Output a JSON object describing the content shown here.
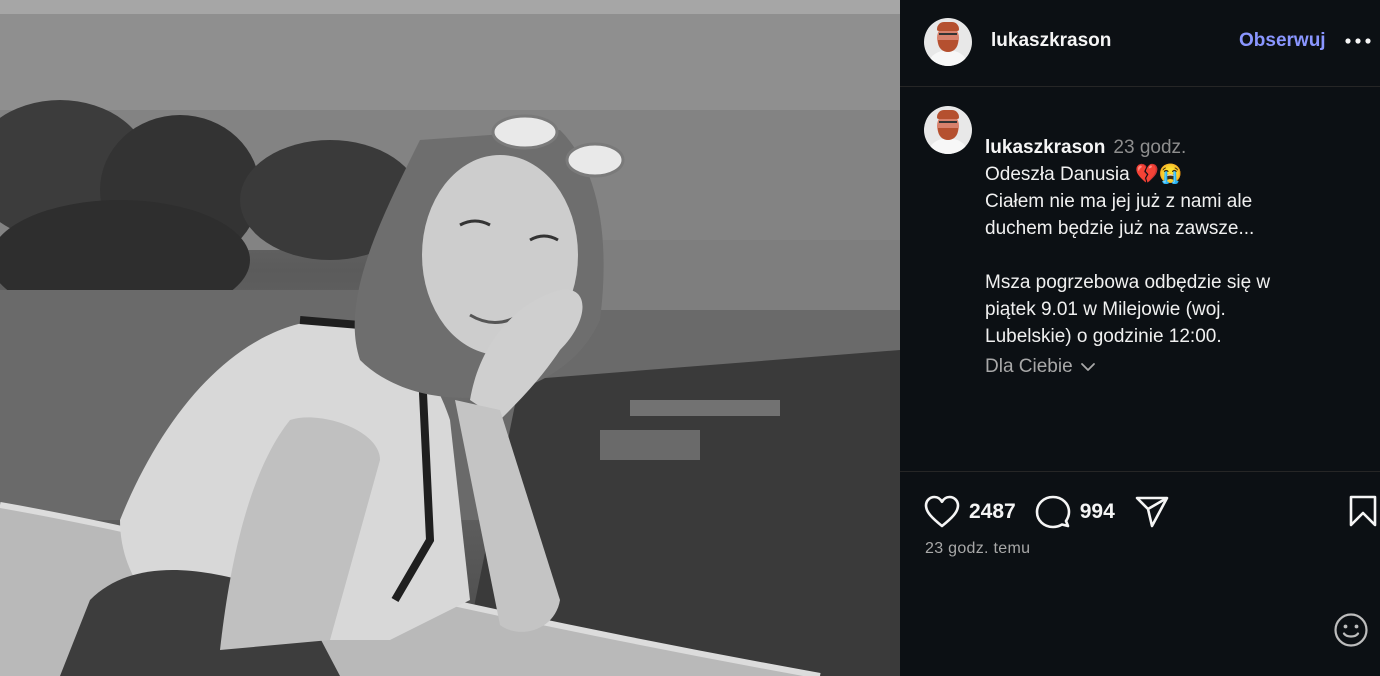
{
  "post": {
    "author": "lukaszkrason",
    "follow_label": "Obserwuj",
    "time_short": "23 godz.",
    "caption_line1": "Odeszła Danusia 💔😭",
    "caption_body": "Ciałem nie ma jej już z nami ale\nduchem będzie już na zawsze...\n\nMsza pogrzebowa odbędzie się w\npiątek 9.01 w Milejowie (woj.\nLubelskie) o godzinie 12:00.",
    "for_you_label": "Dla Ciebie",
    "likes": "2487",
    "comments": "994",
    "posted_ago": "23 godz. temu"
  },
  "icons": {
    "heart": "heart-icon",
    "comment": "comment-icon",
    "share": "share-icon",
    "save": "bookmark-icon",
    "more": "more-icon",
    "emoji": "emoji-icon",
    "chevron": "chevron-down-icon"
  },
  "colors": {
    "panel_bg": "#0c1014",
    "accent_follow": "#8a96ff",
    "muted_text": "#a8a8a8"
  }
}
